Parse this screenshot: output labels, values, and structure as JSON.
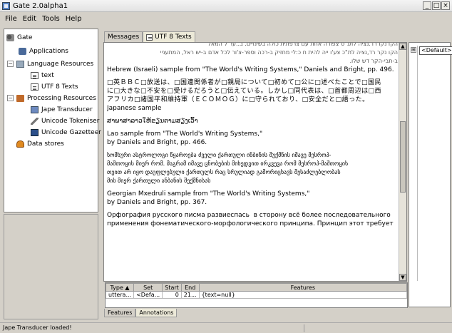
{
  "window": {
    "title": "Gate 2.0alpha1",
    "controls": [
      "_",
      "□",
      "×"
    ]
  },
  "menu": [
    "File",
    "Edit",
    "Tools",
    "Help"
  ],
  "tree": {
    "root": "Gate",
    "applications": "Applications",
    "language_resources": "Language Resources",
    "lr_items": [
      "text",
      "UTF 8 Texts"
    ],
    "processing_resources": "Processing Resources",
    "pr_items": [
      "Jape Transducer",
      "Unicode Tokeniser",
      "Unicode Gazetteer"
    ],
    "data_stores": "Data stores"
  },
  "tabs": [
    "Messages",
    "UTF 8 Texts"
  ],
  "text": {
    "hebrew_1": "הקו נקו רד.נציה לתנ\"ס צפורה אחת עם צרפתית כולה בשינויים. ב..ער ל המאל",
    "hebrew_2": "הקו נקר רד,נציה לת\"כ צע'ו ייה להית ח כ:לי מחזיק ב-רכה וספר-צ'ור לכל אדם ב-יש ראל, המתעניי",
    "hebrew_3": "ב-תבי-הקר דש שלו.",
    "hebrew_caption": "Hebrew (Israeli) sample from \"The World's Writing Systems,\" Daniels and Bright, pp. 496.",
    "japanese_1": "□英ＢＢＣ□放送は、□国連関係者が□親局について□初めて□公に□述べたことで□国民",
    "japanese_2": "に□大きな□不安を□受けるだろうと□伝えている。しかし□同代表は、□首都周辺は□西",
    "japanese_3": "アフリカ□諸国平和維持軍（ＥＣＯＭＯＧ）に□守られており、□安全だと□語った。",
    "japanese_caption": "Japanese sample",
    "lao_1": "ສາພາສາລາວໃຫ້ຂຽນຕາມສຽງເວົ້າ",
    "lao_caption_1": "Lao sample from \"The World's Writing Systems,\"",
    "lao_caption_2": "by Daniels and Bright, pp. 466.",
    "georgian_1": "სომხური ასტროლოგი წყაროება ძველი ქართული ინბინის მუქმნის იმავე მესროპ-",
    "georgian_2": "მაშთოცის მიერ რომ. მაგრამ იმავე ცნობების მიხედვით ირკვევა რომ მესროპ-მაშთოცის",
    "georgian_3": "თვით არ იყო დაუფლებული ქართულს რაც სრულიად გამორიცხავს მესაძლებლობას",
    "georgian_4": "მის მიერ ქართული ანბანის შექმნისას",
    "georgian_caption_1": "Georgian Mxedruli sample from \"The World's Writing Systems,\"",
    "georgian_caption_2": "by Daniels and Bright, pp. 367.",
    "russian_1": "Орфография русского писма развиеспась  в сторону всё более последовательного",
    "russian_2": "применения фонематического-морфологического принципа. Принцип этот требует"
  },
  "annotations": {
    "columns": [
      "Type ▲",
      "Set",
      "Start",
      "End",
      "Features"
    ],
    "rows": [
      [
        "uttera...",
        "<Defa...",
        "0",
        "21...",
        "{text=null}"
      ]
    ]
  },
  "bottom_tabs": [
    "Features",
    "Annotations"
  ],
  "right_panel": {
    "expander": "⊞",
    "default_set": "<Default>"
  },
  "status": "Jape Transducer loaded!"
}
